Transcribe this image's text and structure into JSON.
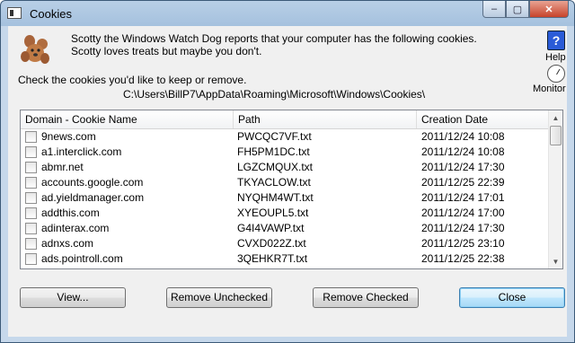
{
  "window": {
    "title": "Cookies",
    "controls": {
      "minimize": "–",
      "maximize": "▢",
      "close": "✕"
    }
  },
  "intro_text": "Scotty the Windows Watch Dog reports that your computer has the following cookies. Scotty loves treats but maybe you don't.",
  "instruction": "Check the cookies you'd like to keep or remove.",
  "cookies_path": "C:\\Users\\BillP7\\AppData\\Roaming\\Microsoft\\Windows\\Cookies\\",
  "side": {
    "help_glyph": "?",
    "help_label": "Help",
    "monitor_label": "Monitor"
  },
  "list": {
    "columns": [
      "Domain - Cookie Name",
      "Path",
      "Creation Date"
    ],
    "rows": [
      {
        "domain": "9news.com",
        "path": "PWCQC7VF.txt",
        "date": "2011/12/24 10:08",
        "checked": false
      },
      {
        "domain": "a1.interclick.com",
        "path": "FH5PM1DC.txt",
        "date": "2011/12/24 10:08",
        "checked": false
      },
      {
        "domain": "abmr.net",
        "path": "LGZCMQUX.txt",
        "date": "2011/12/24 17:30",
        "checked": false
      },
      {
        "domain": "accounts.google.com",
        "path": "TKYACLOW.txt",
        "date": "2011/12/25 22:39",
        "checked": false
      },
      {
        "domain": "ad.yieldmanager.com",
        "path": "NYQHM4WT.txt",
        "date": "2011/12/24 17:01",
        "checked": false
      },
      {
        "domain": "addthis.com",
        "path": "XYEOUPL5.txt",
        "date": "2011/12/24 17:00",
        "checked": false
      },
      {
        "domain": "adinterax.com",
        "path": "G4I4VAWP.txt",
        "date": "2011/12/24 17:30",
        "checked": false
      },
      {
        "domain": "adnxs.com",
        "path": "CVXD022Z.txt",
        "date": "2011/12/25 23:10",
        "checked": false
      },
      {
        "domain": "ads.pointroll.com",
        "path": "3QEHKR7T.txt",
        "date": "2011/12/25 22:38",
        "checked": false
      }
    ]
  },
  "buttons": {
    "view": "View...",
    "remove_unchecked": "Remove Unchecked",
    "remove_checked": "Remove Checked",
    "close": "Close"
  },
  "colors": {
    "accent": "#3c7fb1",
    "help_blue": "#2a5bd7"
  }
}
